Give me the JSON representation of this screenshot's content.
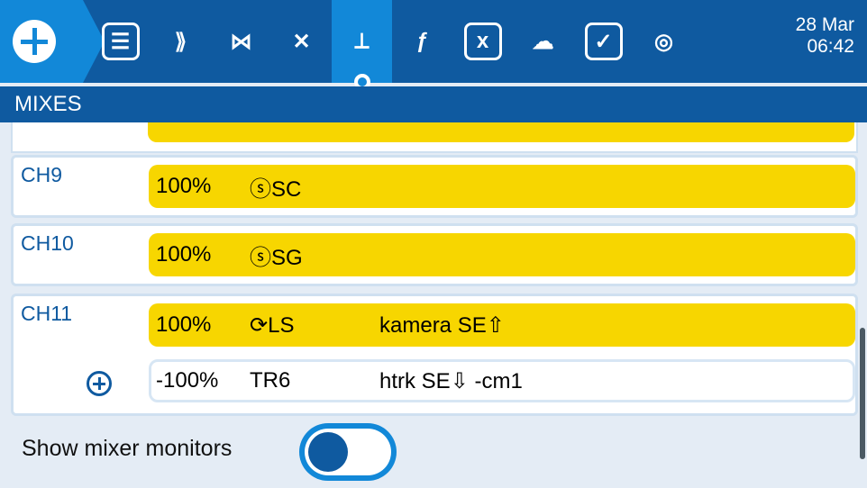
{
  "topbar": {
    "tabs": [
      {
        "name": "model-setup",
        "glyph": "☰"
      },
      {
        "name": "inputs",
        "glyph": "⟫"
      },
      {
        "name": "mixes",
        "glyph": "⋈"
      },
      {
        "name": "outputs",
        "glyph": "✕"
      },
      {
        "name": "curves",
        "glyph": "⟂"
      },
      {
        "name": "gvars",
        "glyph": "ƒ"
      },
      {
        "name": "logical-switches",
        "glyph": "x"
      },
      {
        "name": "special-functions",
        "glyph": "☁"
      },
      {
        "name": "telemetry",
        "glyph": "✓"
      },
      {
        "name": "wifi",
        "glyph": "◎"
      }
    ],
    "active_index": 4,
    "date": "28 Mar",
    "time": "06:42"
  },
  "header": {
    "title": "MIXES"
  },
  "rows": [
    {
      "channel": "CH9",
      "lines": [
        {
          "weight": "100%",
          "source": "ⓢSC",
          "name": ""
        }
      ]
    },
    {
      "channel": "CH10",
      "lines": [
        {
          "weight": "100%",
          "source": "ⓢSG",
          "name": ""
        }
      ]
    },
    {
      "channel": "CH11",
      "lines": [
        {
          "weight": "100%",
          "source": "⟳LS",
          "name": "kamera SE⇧"
        },
        {
          "weight": "-100%",
          "source": "TR6",
          "name": "htrk SE⇩ -cm1"
        }
      ]
    }
  ],
  "footer": {
    "label": "Show mixer monitors",
    "toggle_on": false
  },
  "colors": {
    "top": "#0f5aa0",
    "accent": "#1288d8",
    "mixer_yellow": "#f7d600"
  }
}
